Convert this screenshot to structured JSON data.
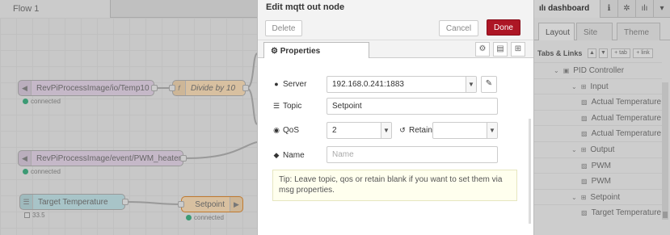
{
  "workspace": {
    "tab_label": "Flow 1",
    "nodes": {
      "temp10": {
        "label": "RevPiProcessImage/io/Temp10",
        "status": "connected"
      },
      "divide": {
        "label": "Divide by 10",
        "icon": "f"
      },
      "pwm": {
        "label": "RevPiProcessImage/event/PWM_heater1",
        "status": "connected"
      },
      "target": {
        "label": "Target Temperature",
        "status": "33.5"
      },
      "setpoint": {
        "label": "Setpoint",
        "status": "connected"
      }
    }
  },
  "editor": {
    "title": "Edit mqtt out node",
    "delete_label": "Delete",
    "cancel_label": "Cancel",
    "done_label": "Done",
    "properties_tab": "Properties",
    "server": {
      "label": "Server",
      "value": "192.168.0.241:1883"
    },
    "topic": {
      "label": "Topic",
      "value": "Setpoint"
    },
    "qos": {
      "label": "QoS",
      "value": "2"
    },
    "retain": {
      "label": "Retain",
      "value": ""
    },
    "name": {
      "label": "Name",
      "placeholder": "Name"
    },
    "tip": "Tip: Leave topic, qos or retain blank if you want to set them via msg properties."
  },
  "sidebar": {
    "tab_label": "dashboard",
    "subtabs": [
      "Layout",
      "Site",
      "Theme"
    ],
    "section_title": "Tabs & Links",
    "mini_buttons": [
      "▲",
      "▼",
      "+ tab",
      "+ link"
    ],
    "tree": [
      {
        "level": 1,
        "label": "PID Controller"
      },
      {
        "level": 2,
        "label": "Input"
      },
      {
        "level": 3,
        "label": "Actual Temperature"
      },
      {
        "level": 3,
        "label": "Actual Temperature"
      },
      {
        "level": 3,
        "label": "Actual Temperature"
      },
      {
        "level": 2,
        "label": "Output"
      },
      {
        "level": 3,
        "label": "PWM"
      },
      {
        "level": 3,
        "label": "PWM"
      },
      {
        "level": 2,
        "label": "Setpoint"
      },
      {
        "level": 3,
        "label": "Target Temperature"
      }
    ]
  }
}
